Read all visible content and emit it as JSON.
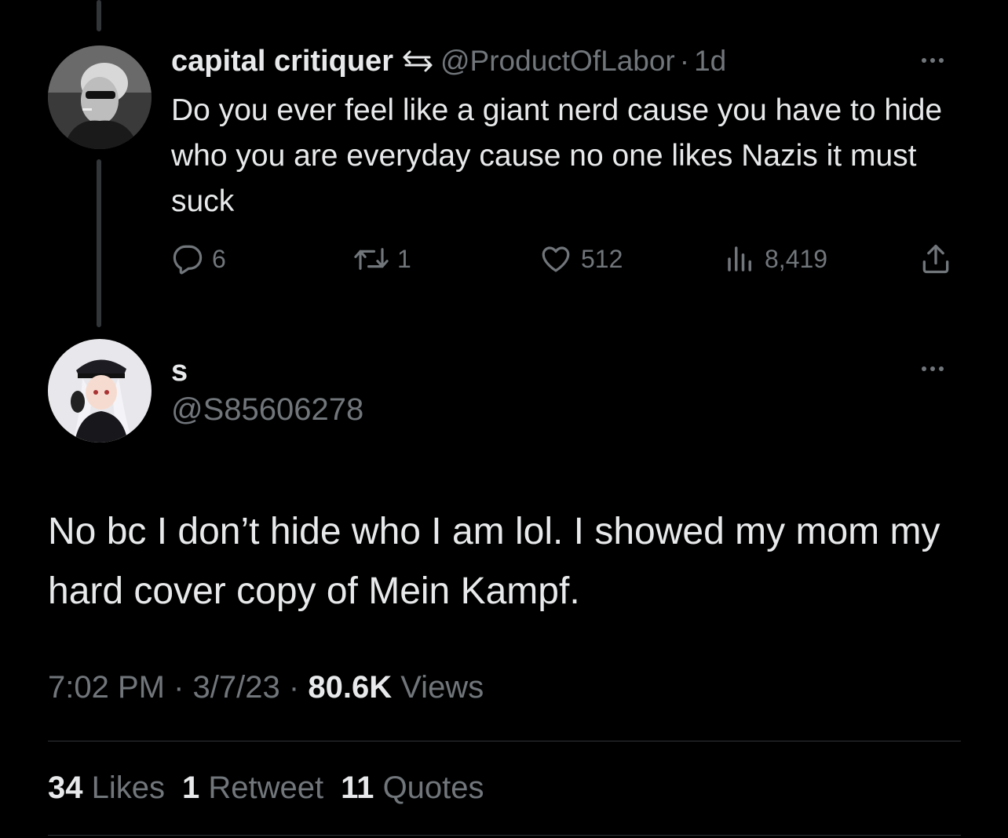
{
  "parent_tweet": {
    "display_name": "capital critiquer",
    "handle": "@ProductOfLabor",
    "separator": "·",
    "time": "1d",
    "text": "Do you ever feel like a giant nerd cause you have to hide who you are everyday cause no one likes Nazis it must suck",
    "actions": {
      "replies": "6",
      "retweets": "1",
      "likes": "512",
      "views": "8,419"
    }
  },
  "reply_tweet": {
    "display_name": "s",
    "handle": "@S85606278",
    "text": "No bc I don’t hide who I am lol. I showed my mom my hard cover copy of Mein Kampf.",
    "meta": {
      "time": "7:02 PM",
      "sep1": "·",
      "date": "3/7/23",
      "sep2": "·",
      "views_count": "80.6K",
      "views_label": "Views"
    },
    "stats": {
      "likes_count": "34",
      "likes_label": "Likes",
      "retweets_count": "1",
      "retweets_label": "Retweet",
      "quotes_count": "11",
      "quotes_label": "Quotes"
    }
  },
  "colors": {
    "background": "#000000",
    "primary_text": "#e7e9ea",
    "secondary_text": "#71767b",
    "divider": "#2f3336"
  },
  "icons": [
    "reply-icon",
    "retweet-icon",
    "like-icon",
    "views-icon",
    "share-icon",
    "more-icon",
    "repost-indicator-icon"
  ]
}
